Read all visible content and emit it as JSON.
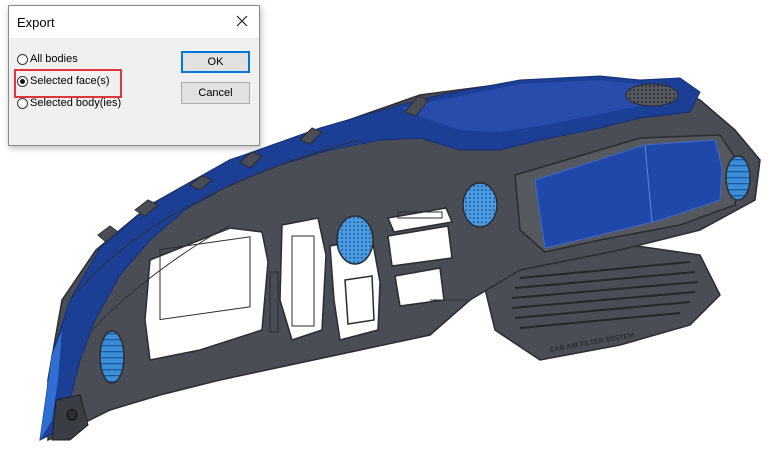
{
  "dialog": {
    "title": "Export",
    "options": [
      {
        "label": "All bodies",
        "selected": false
      },
      {
        "label": "Selected face(s)",
        "selected": true
      },
      {
        "label": "Selected body(ies)",
        "selected": false
      }
    ],
    "ok_label": "OK",
    "cancel_label": "Cancel",
    "highlight_color": "#e0353d"
  },
  "model": {
    "description": "dashboard-cad-model",
    "embossed_text": "CAB AIR FILTER SYSTEM",
    "colors": {
      "selected_face": "#1c3f96",
      "selected_face_light": "#2f5fc4",
      "vent_grille": "#3b8fd8",
      "body_shell": "#4a4d55",
      "edge_lines": "#2a2c31"
    }
  }
}
